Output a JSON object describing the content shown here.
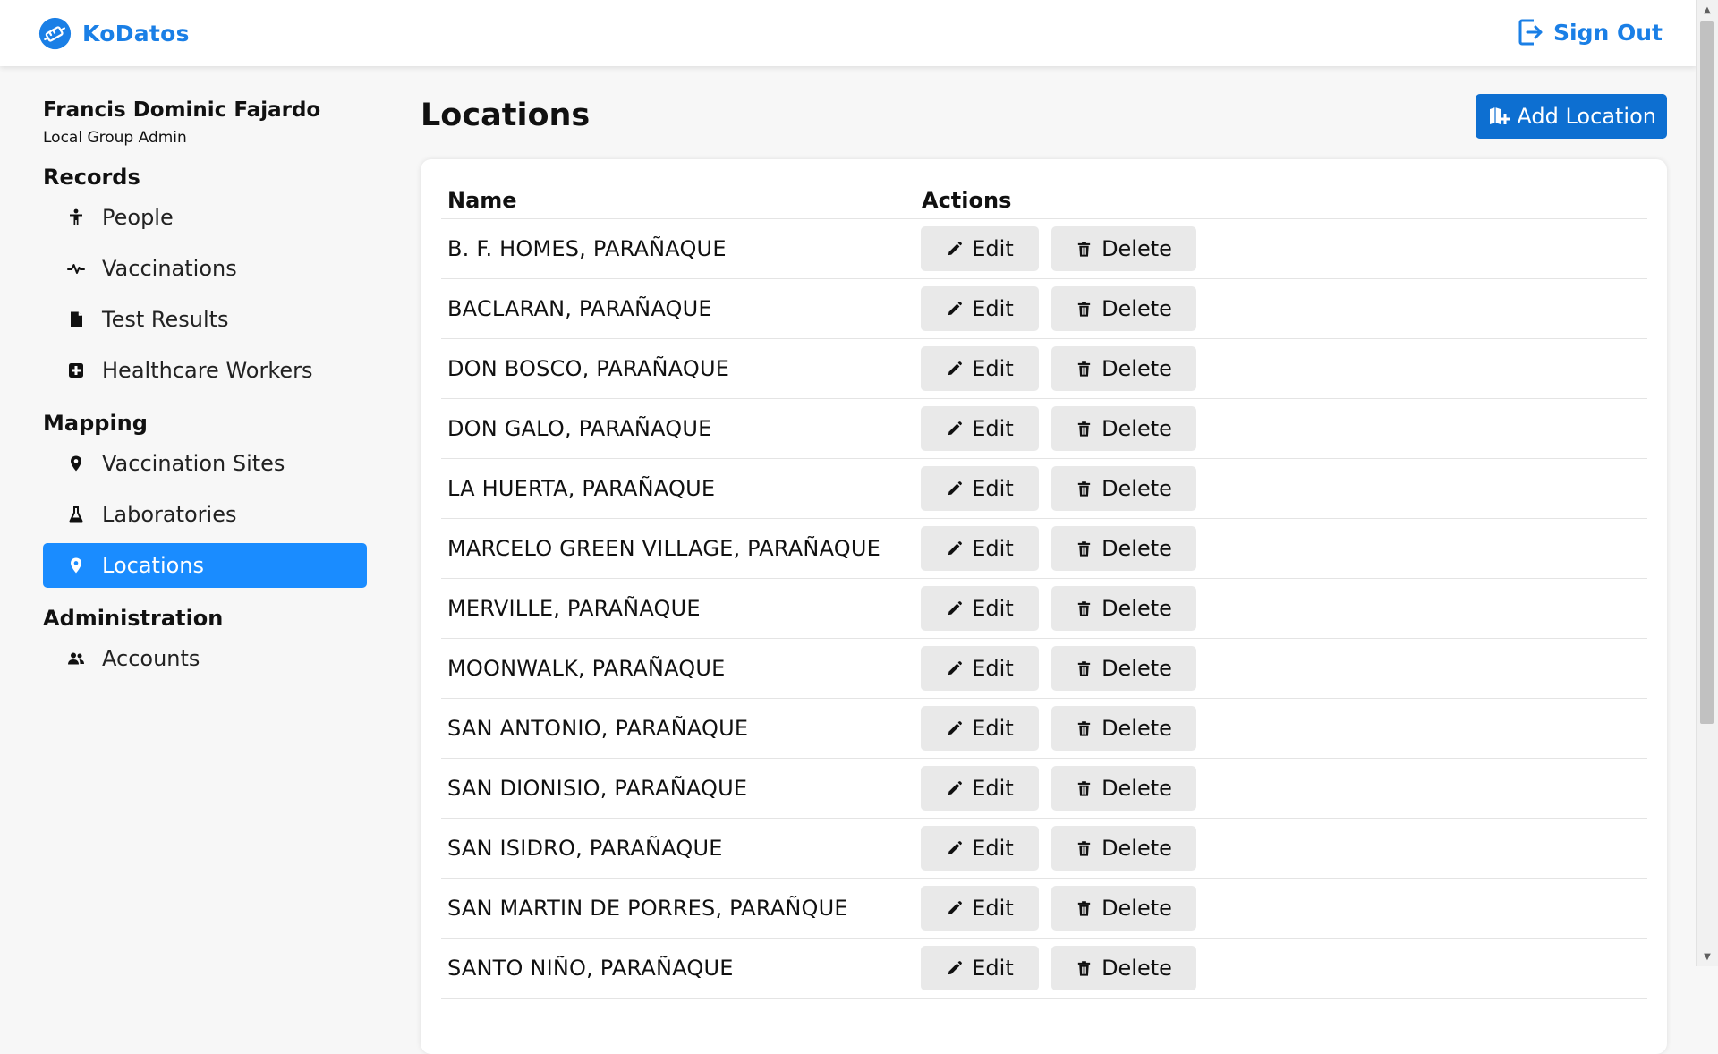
{
  "app": {
    "name": "KoDatos",
    "sign_out_label": "Sign Out"
  },
  "sidebar": {
    "user_name": "Francis Dominic Fajardo",
    "user_role": "Local Group Admin",
    "sections": [
      {
        "title": "Records",
        "items": [
          {
            "label": "People",
            "icon": "person-icon"
          },
          {
            "label": "Vaccinations",
            "icon": "pulse-icon"
          },
          {
            "label": "Test Results",
            "icon": "file-icon"
          },
          {
            "label": "Healthcare Workers",
            "icon": "medical-plus-icon"
          }
        ]
      },
      {
        "title": "Mapping",
        "items": [
          {
            "label": "Vaccination Sites",
            "icon": "pin-icon"
          },
          {
            "label": "Laboratories",
            "icon": "flask-icon"
          },
          {
            "label": "Locations",
            "icon": "pin-icon",
            "active": true
          }
        ]
      },
      {
        "title": "Administration",
        "items": [
          {
            "label": "Accounts",
            "icon": "people-icon"
          }
        ]
      }
    ]
  },
  "main": {
    "title": "Locations",
    "add_button_label": "Add Location",
    "table": {
      "columns": [
        "Name",
        "Actions"
      ],
      "edit_label": "Edit",
      "delete_label": "Delete",
      "rows": [
        "B. F. HOMES, PARAÑAQUE",
        "BACLARAN, PARAÑAQUE",
        "DON BOSCO, PARAÑAQUE",
        "DON GALO, PARAÑAQUE",
        "LA HUERTA, PARAÑAQUE",
        "MARCELO GREEN VILLAGE, PARAÑAQUE",
        "MERVILLE, PARAÑAQUE",
        "MOONWALK, PARAÑAQUE",
        "SAN ANTONIO, PARAÑAQUE",
        "SAN DIONISIO, PARAÑAQUE",
        "SAN ISIDRO, PARAÑAQUE",
        "SAN MARTIN DE PORRES, PARAÑQUE",
        "SANTO NIÑO, PARAÑAQUE"
      ]
    }
  },
  "colors": {
    "brand": "#1a7fe6",
    "active_nav": "#1a8cff",
    "primary_button": "#0d6fd1",
    "secondary_button": "#e9e9e9"
  }
}
